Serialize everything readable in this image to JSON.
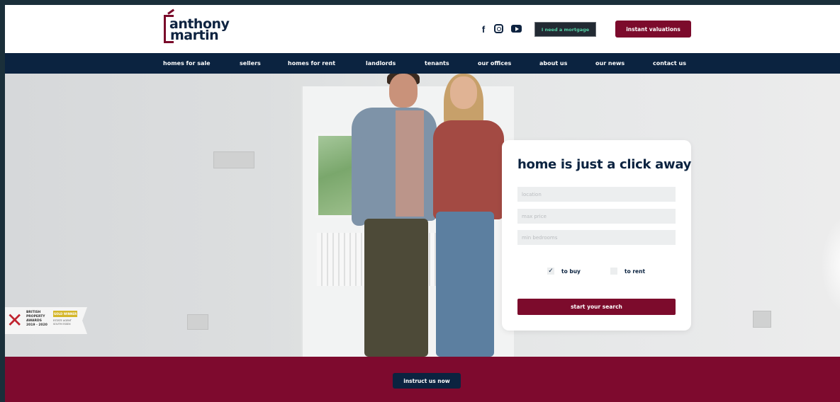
{
  "brand": {
    "logo_line1": "anthony",
    "logo_line2": "martin",
    "accent_color": "#7c0b2c",
    "navy_color": "#0b2340"
  },
  "header": {
    "social_icons": [
      "facebook-icon",
      "instagram-icon",
      "youtube-icon"
    ],
    "mortgage_button": "I need a mortgage",
    "valuation_button": "instant valuations"
  },
  "nav": {
    "items": [
      {
        "label": "homes for sale"
      },
      {
        "label": "sellers"
      },
      {
        "label": "homes for rent"
      },
      {
        "label": "landlords"
      },
      {
        "label": "tenants"
      },
      {
        "label": "our offices"
      },
      {
        "label": "about us"
      },
      {
        "label": "our news"
      },
      {
        "label": "contact us"
      }
    ]
  },
  "search": {
    "title": "home is just a click away",
    "fields": [
      {
        "placeholder": "location"
      },
      {
        "placeholder": "max price"
      },
      {
        "placeholder": "min bedrooms"
      }
    ],
    "options": [
      {
        "label": "to buy",
        "checked": true
      },
      {
        "label": "to rent",
        "checked": false
      }
    ],
    "submit": "start your search"
  },
  "award": {
    "text": "BRITISH PROPERTY AWARDS 2019 · 2020",
    "badge": "GOLD WINNER",
    "sub": "ESTATE AGENT SOUTH ESSEX"
  },
  "footer_band": {
    "cta": "instruct us now"
  }
}
